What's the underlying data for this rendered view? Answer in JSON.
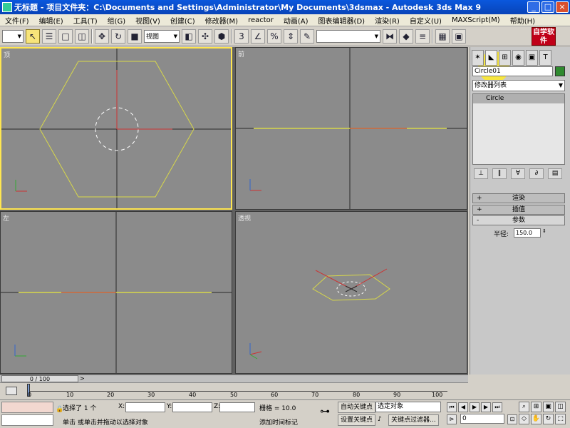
{
  "window": {
    "title": "无标题 - 项目文件夹：C:\\Documents and Settings\\Administrator\\My Documents\\3dsmax - Autodesk 3ds Max 9",
    "minimize": "_",
    "restore": "□",
    "close": "×"
  },
  "menu": [
    "文件(F)",
    "编辑(E)",
    "工具(T)",
    "组(G)",
    "视图(V)",
    "创建(C)",
    "修改器(M)",
    "reactor",
    "动画(A)",
    "图表编辑器(D)",
    "渲染(R)",
    "自定义(U)",
    "MAXScript(M)",
    "帮助(H)"
  ],
  "toolbar": {
    "selection_set": "",
    "ref_coord": "视图",
    "named_sel": ""
  },
  "logo_text": "自学软件",
  "viewports": {
    "top_label": "顶",
    "front_label": "前",
    "left_label": "左",
    "persp_label": "透视"
  },
  "command_panel": {
    "object_name": "Circle01",
    "modifier_list": "修改器列表",
    "stack_item": "Circle",
    "rollout_render": "渲染",
    "rollout_interp": "插值",
    "rollout_params": "参数",
    "radius_label": "半径:",
    "radius_value": "150.0",
    "plus": "+",
    "minus": "-"
  },
  "timeline": {
    "frame_display": "0 / 100",
    "next": ">",
    "ticks": [
      "0",
      "10",
      "20",
      "30",
      "40",
      "50",
      "60",
      "70",
      "80",
      "90",
      "100"
    ]
  },
  "status": {
    "selected": "选择了 1 个",
    "x_label": "X:",
    "y_label": "Y:",
    "z_label": "Z:",
    "grid": "栅格 = 10.0",
    "prompt": "单击 或单击并拖动以选择对象",
    "add_tag": "添加时间标记",
    "auto_key": "自动关键点",
    "set_key": "设置关键点",
    "key_mode": "选定对象",
    "key_filters": "关键点过滤器...",
    "frame": "0"
  },
  "colors": {
    "viewport_bg": "#8b8b8b",
    "active_border": "#ffe650",
    "shape_yellow": "#d8d84a",
    "gizmo_red": "#cc3333"
  }
}
